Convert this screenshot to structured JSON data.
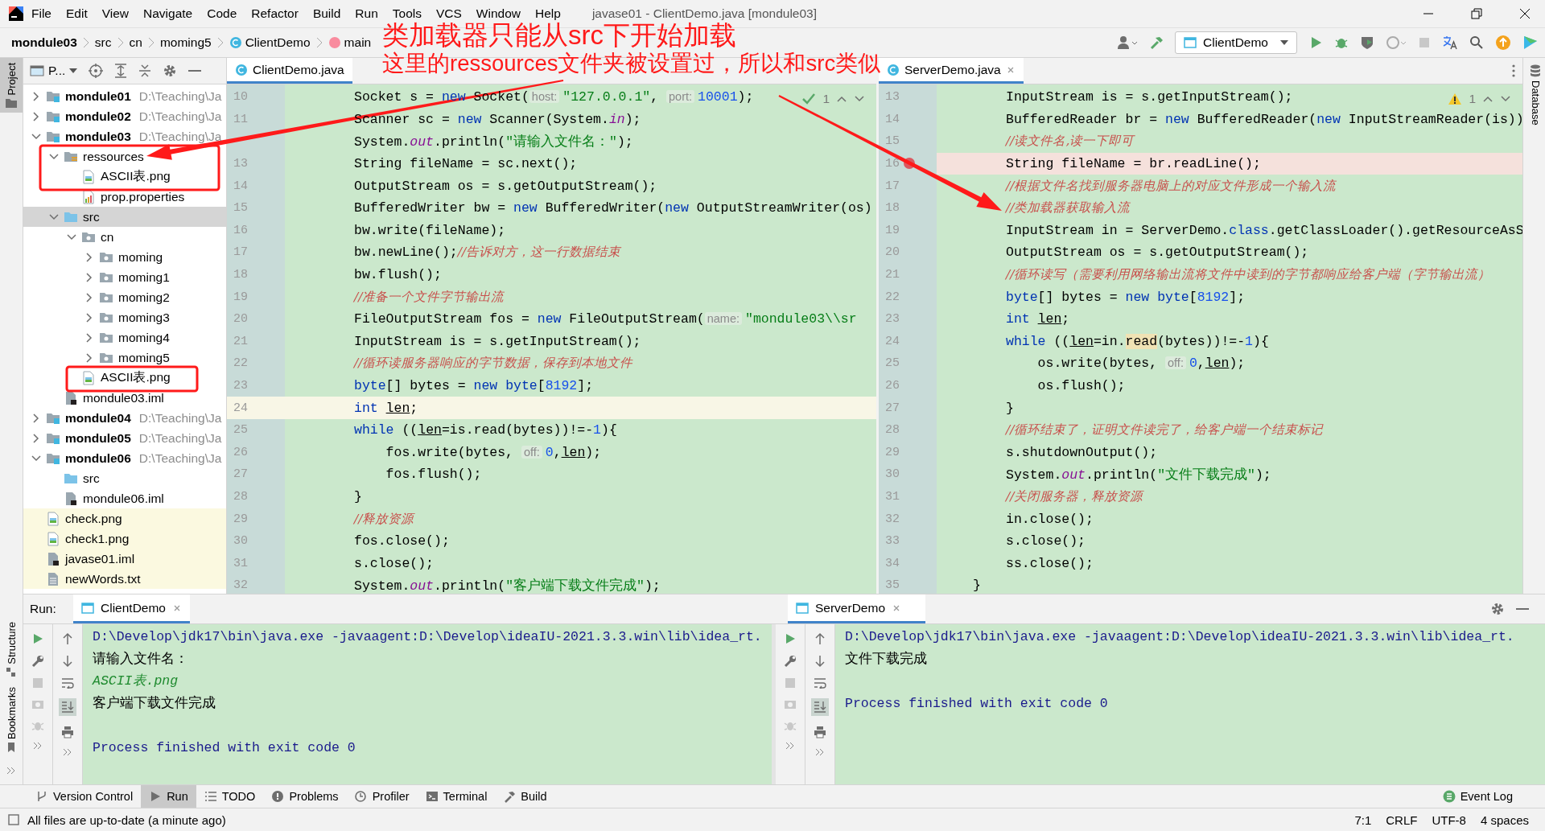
{
  "window": {
    "title": "javase01 - ClientDemo.java [mondule03]"
  },
  "menu": [
    "File",
    "Edit",
    "View",
    "Navigate",
    "Code",
    "Refactor",
    "Build",
    "Run",
    "Tools",
    "VCS",
    "Window",
    "Help"
  ],
  "breadcrumbs": [
    {
      "label": "mondule03",
      "kind": "module"
    },
    {
      "label": "src",
      "kind": "folder"
    },
    {
      "label": "cn",
      "kind": "folder"
    },
    {
      "label": "moming5",
      "kind": "folder"
    },
    {
      "label": "ClientDemo",
      "kind": "class"
    },
    {
      "label": "main",
      "kind": "method"
    }
  ],
  "run_config": "ClientDemo",
  "side_tabs": {
    "left_top": [
      {
        "label": "Project",
        "selected": true
      }
    ],
    "left_bottom": [
      {
        "label": "Structure",
        "selected": false
      },
      {
        "label": "Bookmarks",
        "selected": false
      }
    ],
    "right": [
      {
        "label": "Database",
        "selected": false
      }
    ]
  },
  "project": {
    "title": "P...",
    "tree": [
      {
        "name": "mondule01",
        "path": "D:\\Teaching\\Ja",
        "kind": "module",
        "expanded": false,
        "selected": false
      },
      {
        "name": "mondule02",
        "path": "D:\\Teaching\\Ja",
        "kind": "module",
        "expanded": false,
        "selected": false
      },
      {
        "name": "mondule03",
        "path": "D:\\Teaching\\Ja",
        "kind": "module",
        "expanded": true,
        "selected": false,
        "children": [
          {
            "name": "ressources",
            "kind": "resources",
            "expanded": true,
            "selected": false,
            "children": [
              {
                "name": "ASCII表.png",
                "kind": "image",
                "selected": false
              },
              {
                "name": "prop.properties",
                "kind": "properties",
                "selected": false
              }
            ]
          },
          {
            "name": "src",
            "kind": "source",
            "expanded": true,
            "selected": true,
            "children": [
              {
                "name": "cn",
                "kind": "package",
                "expanded": true,
                "selected": false,
                "children": [
                  {
                    "name": "moming",
                    "kind": "package",
                    "expanded": false,
                    "selected": false
                  },
                  {
                    "name": "moming1",
                    "kind": "package",
                    "expanded": false,
                    "selected": false
                  },
                  {
                    "name": "moming2",
                    "kind": "package",
                    "expanded": false,
                    "selected": false
                  },
                  {
                    "name": "moming3",
                    "kind": "package",
                    "expanded": false,
                    "selected": false
                  },
                  {
                    "name": "moming4",
                    "kind": "package",
                    "expanded": false,
                    "selected": false
                  },
                  {
                    "name": "moming5",
                    "kind": "package",
                    "expanded": false,
                    "selected": false
                  }
                ]
              },
              {
                "name": "ASCII表.png",
                "kind": "image",
                "selected": false
              }
            ]
          },
          {
            "name": "mondule03.iml",
            "kind": "iml",
            "selected": false
          }
        ]
      },
      {
        "name": "mondule04",
        "path": "D:\\Teaching\\Ja",
        "kind": "module",
        "expanded": false,
        "selected": false
      },
      {
        "name": "mondule05",
        "path": "D:\\Teaching\\Ja",
        "kind": "module",
        "expanded": false,
        "selected": false
      },
      {
        "name": "mondule06",
        "path": "D:\\Teaching\\Ja",
        "kind": "module",
        "expanded": true,
        "selected": false,
        "children": [
          {
            "name": "src",
            "kind": "source",
            "selected": false
          },
          {
            "name": "mondule06.iml",
            "kind": "iml",
            "selected": false
          }
        ]
      },
      {
        "name": "check.png",
        "kind": "image",
        "outside": true,
        "selected": false
      },
      {
        "name": "check1.png",
        "kind": "image",
        "outside": true,
        "selected": false
      },
      {
        "name": "javase01.iml",
        "kind": "iml",
        "outside": true,
        "selected": false
      },
      {
        "name": "newWords.txt",
        "kind": "text",
        "outside": true,
        "selected": false
      }
    ]
  },
  "editors": [
    {
      "tab": {
        "label": "ClientDemo.java",
        "selected": true
      },
      "inspection": {
        "kind": "ok",
        "count": "1"
      },
      "lines": [
        {
          "num": "10",
          "tokens": [
            {
              "text": "Socket s = ",
              "kind": "plain"
            },
            {
              "text": "new",
              "kind": "keyword"
            },
            {
              "text": " Socket(",
              "kind": "plain"
            },
            {
              "text": "host:",
              "kind": "hint"
            },
            {
              "text": "\"127.0.0.1\"",
              "kind": "string"
            },
            {
              "text": ", ",
              "kind": "plain"
            },
            {
              "text": "port:",
              "kind": "hint"
            },
            {
              "text": "10001",
              "kind": "number"
            },
            {
              "text": ");",
              "kind": "plain"
            }
          ]
        },
        {
          "num": "11",
          "tokens": [
            {
              "text": "Scanner sc = ",
              "kind": "plain"
            },
            {
              "text": "new",
              "kind": "keyword"
            },
            {
              "text": " Scanner(System.",
              "kind": "plain"
            },
            {
              "text": "in",
              "kind": "field"
            },
            {
              "text": ");",
              "kind": "plain"
            }
          ]
        },
        {
          "tokens": [
            {
              "text": "System.",
              "kind": "plain"
            },
            {
              "text": "out",
              "kind": "field"
            },
            {
              "text": ".println(",
              "kind": "plain"
            },
            {
              "text": "\"请输入文件名：\"",
              "kind": "string"
            },
            {
              "text": ");",
              "kind": "plain"
            }
          ]
        },
        {
          "num": "13",
          "tokens": [
            {
              "text": "String fileName = sc.next();",
              "kind": "plain"
            }
          ]
        },
        {
          "num": "14",
          "tokens": [
            {
              "text": "OutputStream os = s.getOutputStream();",
              "kind": "plain"
            }
          ]
        },
        {
          "num": "15",
          "tokens": [
            {
              "text": "BufferedWriter bw = ",
              "kind": "plain"
            },
            {
              "text": "new",
              "kind": "keyword"
            },
            {
              "text": " BufferedWriter(",
              "kind": "plain"
            },
            {
              "text": "new",
              "kind": "keyword"
            },
            {
              "text": " OutputStreamWriter(os)",
              "kind": "plain"
            }
          ]
        },
        {
          "num": "16",
          "tokens": [
            {
              "text": "bw.write(fileName);",
              "kind": "plain"
            }
          ]
        },
        {
          "num": "17",
          "tokens": [
            {
              "text": "bw.newLine();",
              "kind": "plain"
            },
            {
              "text": "//告诉对方，这一行数据结束",
              "kind": "comment"
            }
          ]
        },
        {
          "num": "18",
          "tokens": [
            {
              "text": "bw.flush();",
              "kind": "plain"
            }
          ]
        },
        {
          "num": "19",
          "tokens": [
            {
              "text": "//准备一个文件字节输出流",
              "kind": "comment"
            }
          ]
        },
        {
          "num": "20",
          "tokens": [
            {
              "text": "FileOutputStream fos = ",
              "kind": "plain"
            },
            {
              "text": "new",
              "kind": "keyword"
            },
            {
              "text": " FileOutputStream(",
              "kind": "plain"
            },
            {
              "text": "name:",
              "kind": "hint"
            },
            {
              "text": "\"mondule03\\\\sr",
              "kind": "string"
            }
          ]
        },
        {
          "num": "21",
          "tokens": [
            {
              "text": "InputStream is = s.getInputStream();",
              "kind": "plain"
            }
          ]
        },
        {
          "num": "22",
          "tokens": [
            {
              "text": "//循环读服务器响应的字节数据，保存到本地文件",
              "kind": "comment"
            }
          ]
        },
        {
          "num": "23",
          "tokens": [
            {
              "text": "byte",
              "kind": "keyword"
            },
            {
              "text": "[] bytes = ",
              "kind": "plain"
            },
            {
              "text": "new byte",
              "kind": "keyword"
            },
            {
              "text": "[",
              "kind": "plain"
            },
            {
              "text": "8192",
              "kind": "number"
            },
            {
              "text": "];",
              "kind": "plain"
            }
          ]
        },
        {
          "num": "24",
          "kind": "current",
          "tokens": [
            {
              "text": "int ",
              "kind": "keyword"
            },
            {
              "text": "len",
              "kind": "var"
            },
            {
              "text": ";",
              "kind": "plain"
            }
          ]
        },
        {
          "num": "25",
          "tokens": [
            {
              "text": "while",
              "kind": "keyword"
            },
            {
              "text": " ((",
              "kind": "plain"
            },
            {
              "text": "len",
              "kind": "var"
            },
            {
              "text": "=is.read(bytes))!=-",
              "kind": "plain"
            },
            {
              "text": "1",
              "kind": "number"
            },
            {
              "text": "){",
              "kind": "plain"
            }
          ],
          "children": [
            {
              "num": "26",
              "tokens": [
                {
                  "text": "fos.write(bytes, ",
                  "kind": "plain"
                },
                {
                  "text": "off:",
                  "kind": "hint"
                },
                {
                  "text": "0",
                  "kind": "number"
                },
                {
                  "text": ",",
                  "kind": "plain"
                },
                {
                  "text": "len",
                  "kind": "var"
                },
                {
                  "text": ");",
                  "kind": "plain"
                }
              ]
            },
            {
              "num": "27",
              "tokens": [
                {
                  "text": "fos.flush();",
                  "kind": "plain"
                }
              ]
            }
          ]
        },
        {
          "num": "28",
          "tokens": [
            {
              "text": "}",
              "kind": "plain"
            }
          ]
        },
        {
          "num": "29",
          "tokens": [
            {
              "text": "//释放资源",
              "kind": "comment"
            }
          ]
        },
        {
          "num": "30",
          "tokens": [
            {
              "text": "fos.close();",
              "kind": "plain"
            }
          ]
        },
        {
          "num": "31",
          "tokens": [
            {
              "text": "s.close();",
              "kind": "plain"
            }
          ]
        },
        {
          "num": "32",
          "tokens": [
            {
              "text": "System.",
              "kind": "plain"
            },
            {
              "text": "out",
              "kind": "field"
            },
            {
              "text": ".println(",
              "kind": "plain"
            },
            {
              "text": "\"客户端下载文件完成\"",
              "kind": "string"
            },
            {
              "text": ");",
              "kind": "plain"
            }
          ]
        }
      ]
    },
    {
      "tab": {
        "label": "ServerDemo.java",
        "selected": true
      },
      "inspection": {
        "kind": "warning",
        "count": "1"
      },
      "lines": [
        {
          "num": "13",
          "tokens": [
            {
              "text": "InputStream is = s.getInputStream();",
              "kind": "plain"
            }
          ]
        },
        {
          "num": "14",
          "tokens": [
            {
              "text": "BufferedReader br = ",
              "kind": "plain"
            },
            {
              "text": "new",
              "kind": "keyword"
            },
            {
              "text": " BufferedReader(",
              "kind": "plain"
            },
            {
              "text": "new",
              "kind": "keyword"
            },
            {
              "text": " InputStreamReader(is))",
              "kind": "plain"
            }
          ]
        },
        {
          "num": "15",
          "tokens": [
            {
              "text": "//读文件名,读一下即可",
              "kind": "comment"
            }
          ]
        },
        {
          "num": "16",
          "kind": "breakpoint",
          "tokens": [
            {
              "text": "String fileName = br.readLine();",
              "kind": "plain"
            }
          ]
        },
        {
          "num": "17",
          "tokens": [
            {
              "text": "//根据文件名找到服务器电脑上的对应文件形成一个输入流",
              "kind": "comment"
            }
          ]
        },
        {
          "num": "18",
          "tokens": [
            {
              "text": "//类加载器获取输入流",
              "kind": "comment"
            }
          ]
        },
        {
          "num": "19",
          "tokens": [
            {
              "text": "InputStream in = ServerDemo.",
              "kind": "plain"
            },
            {
              "text": "class",
              "kind": "keyword"
            },
            {
              "text": ".getClassLoader().getResourceAsS",
              "kind": "plain"
            }
          ]
        },
        {
          "num": "20",
          "tokens": [
            {
              "text": "OutputStream os = s.getOutputStream();",
              "kind": "plain"
            }
          ]
        },
        {
          "num": "21",
          "tokens": [
            {
              "text": "//循环读写（需要利用网络输出流将文件中读到的字节都响应给客户端（字节输出流）",
              "kind": "comment"
            }
          ]
        },
        {
          "num": "22",
          "tokens": [
            {
              "text": "byte",
              "kind": "keyword"
            },
            {
              "text": "[] bytes = ",
              "kind": "plain"
            },
            {
              "text": "new byte",
              "kind": "keyword"
            },
            {
              "text": "[",
              "kind": "plain"
            },
            {
              "text": "8192",
              "kind": "number"
            },
            {
              "text": "];",
              "kind": "plain"
            }
          ]
        },
        {
          "num": "23",
          "tokens": [
            {
              "text": "int ",
              "kind": "keyword"
            },
            {
              "text": "len",
              "kind": "var"
            },
            {
              "text": ";",
              "kind": "plain"
            }
          ]
        },
        {
          "num": "24",
          "tokens": [
            {
              "text": "while",
              "kind": "keyword"
            },
            {
              "text": " ((",
              "kind": "plain"
            },
            {
              "text": "len",
              "kind": "var"
            },
            {
              "text": "=in.",
              "kind": "plain"
            },
            {
              "text": "read",
              "kind": "match"
            },
            {
              "text": "(bytes))!=-",
              "kind": "plain"
            },
            {
              "text": "1",
              "kind": "number"
            },
            {
              "text": "){",
              "kind": "plain"
            }
          ],
          "children": [
            {
              "num": "25",
              "tokens": [
                {
                  "text": "os.write(bytes, ",
                  "kind": "plain"
                },
                {
                  "text": "off:",
                  "kind": "hint"
                },
                {
                  "text": "0",
                  "kind": "number"
                },
                {
                  "text": ",",
                  "kind": "plain"
                },
                {
                  "text": "len",
                  "kind": "var"
                },
                {
                  "text": ");",
                  "kind": "plain"
                }
              ]
            },
            {
              "num": "26",
              "tokens": [
                {
                  "text": "os.flush();",
                  "kind": "plain"
                }
              ]
            }
          ]
        },
        {
          "num": "27",
          "tokens": [
            {
              "text": "}",
              "kind": "plain"
            }
          ]
        },
        {
          "num": "28",
          "tokens": [
            {
              "text": "//循环结束了，证明文件读完了，给客户端一个结束标记",
              "kind": "comment"
            }
          ]
        },
        {
          "num": "29",
          "tokens": [
            {
              "text": "s.shutdownOutput();",
              "kind": "plain"
            }
          ]
        },
        {
          "num": "30",
          "tokens": [
            {
              "text": "System.",
              "kind": "plain"
            },
            {
              "text": "out",
              "kind": "field"
            },
            {
              "text": ".println(",
              "kind": "plain"
            },
            {
              "text": "\"文件下载完成\"",
              "kind": "string"
            },
            {
              "text": ");",
              "kind": "plain"
            }
          ]
        },
        {
          "num": "31",
          "tokens": [
            {
              "text": "//关闭服务器，释放资源",
              "kind": "comment"
            }
          ]
        },
        {
          "num": "32",
          "tokens": [
            {
              "text": "in.close();",
              "kind": "plain"
            }
          ]
        },
        {
          "num": "33",
          "tokens": [
            {
              "text": "s.close();",
              "kind": "plain"
            }
          ]
        },
        {
          "num": "34",
          "tokens": [
            {
              "text": "ss.close();",
              "kind": "plain"
            }
          ]
        },
        {
          "num": "35",
          "kind": "outer",
          "tokens": [
            {
              "text": "}",
              "kind": "plain"
            }
          ]
        }
      ]
    }
  ],
  "run": {
    "label": "Run:",
    "panels": [
      {
        "tab": {
          "label": "ClientDemo",
          "selected": true
        },
        "lines": [
          {
            "text": "D:\\Develop\\jdk17\\bin\\java.exe -javaagent:D:\\Develop\\ideaIU-2021.3.3.win\\lib\\idea_rt.",
            "kind": "system"
          },
          {
            "text": "请输入文件名：",
            "kind": "out"
          },
          {
            "text": "ASCII表.png",
            "kind": "input"
          },
          {
            "text": "客户端下载文件完成",
            "kind": "out"
          },
          {
            "kind": "blank"
          },
          {
            "text": "Process finished with exit code 0",
            "kind": "system"
          }
        ]
      },
      {
        "tab": {
          "label": "ServerDemo",
          "selected": true
        },
        "lines": [
          {
            "text": "D:\\Develop\\jdk17\\bin\\java.exe -javaagent:D:\\Develop\\ideaIU-2021.3.3.win\\lib\\idea_rt.",
            "kind": "system"
          },
          {
            "text": "文件下载完成",
            "kind": "out"
          },
          {
            "kind": "blank"
          },
          {
            "text": "Process finished with exit code 0",
            "kind": "system"
          }
        ]
      }
    ]
  },
  "tool_windows": [
    {
      "label": "Version Control",
      "kind": "vcs",
      "selected": false
    },
    {
      "label": "Run",
      "kind": "run",
      "selected": true
    },
    {
      "label": "TODO",
      "kind": "todo",
      "selected": false
    },
    {
      "label": "Problems",
      "kind": "problems",
      "selected": false
    },
    {
      "label": "Profiler",
      "kind": "profiler",
      "selected": false
    },
    {
      "label": "Terminal",
      "kind": "terminal",
      "selected": false
    },
    {
      "label": "Build",
      "kind": "build",
      "selected": false
    }
  ],
  "event_log": "Event Log",
  "status_bar": {
    "message": "All files are up-to-date (a minute ago)",
    "items": [
      "7:1",
      "CRLF",
      "UTF-8",
      "4 spaces"
    ]
  },
  "annotations": [
    "类加载器只能从src下开始加载",
    "这里的ressources文件夹被设置过，所以和src类似"
  ]
}
